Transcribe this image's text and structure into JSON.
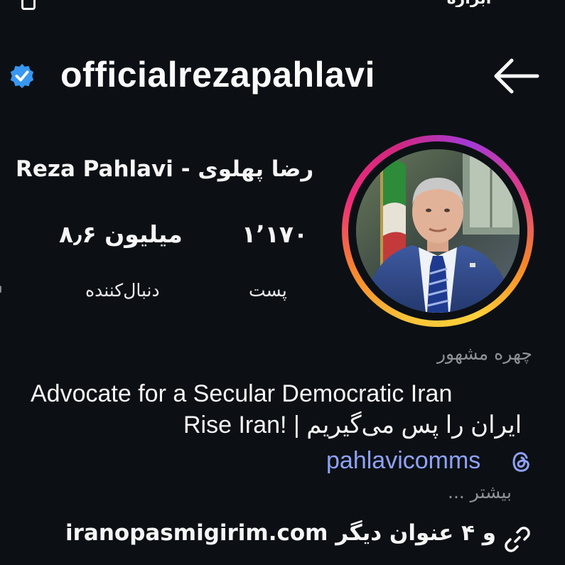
{
  "header": {
    "top_partial": "ابزاره",
    "username": "officialrezapahlavi"
  },
  "profile": {
    "full_name": "Reza Pahlavi - رضا پهلوی",
    "category": "چهره مشهور",
    "stats": {
      "followers_value": "۸٫۶ میلیون",
      "followers_label": "دنبال‌کننده",
      "posts_value": "۱٬۱۷۰",
      "posts_label": "پست"
    },
    "bio_line1": "Advocate for a Secular Democratic Iran",
    "bio_line2": "Rise Iran! | ایران را پس می‌گیریم",
    "threads_handle": "pahlavicomms",
    "more_label": "... بیشتر",
    "link_text": "iranopasmigirim.com",
    "link_suffix": " و ۴ عنوان دیگر"
  },
  "colors": {
    "background": "#0c1014",
    "verified_badge": "#3897f0",
    "threads_link": "#8ea2f7",
    "muted_text": "#8e9196"
  },
  "icons": [
    "back-arrow-icon",
    "verified-badge-icon",
    "threads-icon",
    "link-icon"
  ]
}
